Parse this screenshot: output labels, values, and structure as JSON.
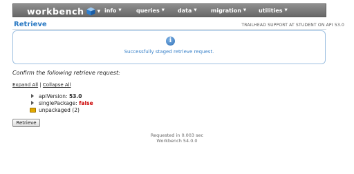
{
  "nav": {
    "logo": "workbench",
    "menus": [
      {
        "label": "info"
      },
      {
        "label": "queries"
      },
      {
        "label": "data"
      },
      {
        "label": "migration"
      },
      {
        "label": "utilities"
      }
    ]
  },
  "page": {
    "title": "Retrieve",
    "user_info": "TRAILHEAD SUPPORT AT STUDENT ON API 53.0"
  },
  "message": {
    "icon": "info-icon",
    "text": "Successfully staged retrieve request."
  },
  "confirm_text": "Confirm the following retrieve request:",
  "tree_controls": {
    "expand": "Expand All",
    "separator": "|",
    "collapse": "Collapse All"
  },
  "tree": {
    "items": [
      {
        "key": "apiVersion:",
        "value": "53.0"
      },
      {
        "key": "singlePackage:",
        "value": "false"
      },
      {
        "key": "unpackaged (2)"
      }
    ]
  },
  "retrieve_button": "Retrieve",
  "footer": {
    "line1": "Requested in 0.003 sec",
    "line2": "Workbench 54.0.0"
  },
  "colors": {
    "accent": "#2a79c3",
    "false_value": "#cc0000",
    "navbar": "#7a7a7a"
  }
}
